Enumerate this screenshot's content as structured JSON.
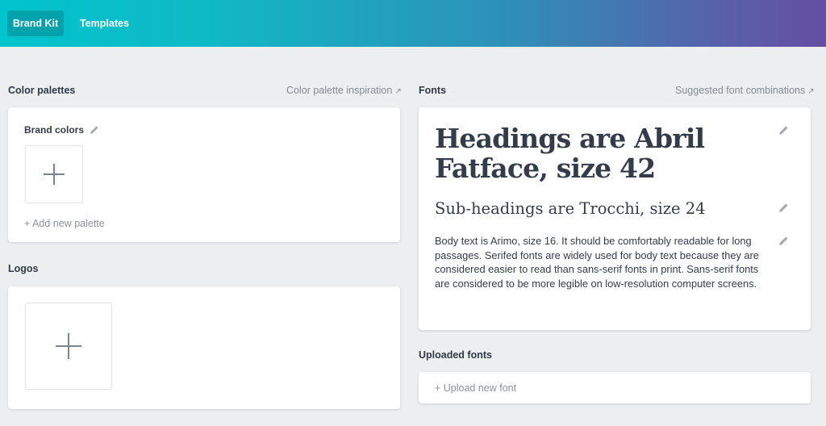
{
  "nav": {
    "tabs": [
      {
        "label": "Brand Kit",
        "active": true
      },
      {
        "label": "Templates",
        "active": false
      }
    ]
  },
  "colors": {
    "accent": "#00c4cc",
    "gradient_end": "#654fa2",
    "background": "#eceef0",
    "text": "#333c48",
    "muted": "#838b94"
  },
  "color_palettes": {
    "title": "Color palettes",
    "link": "Color palette inspiration",
    "link_icon": "external-arrow-icon",
    "palette_name": "Brand colors",
    "add_tile_icon": "plus-icon",
    "add_palette": "+ Add new palette"
  },
  "logos": {
    "title": "Logos",
    "add_tile_icon": "plus-icon"
  },
  "fonts": {
    "title": "Fonts",
    "link": "Suggested font combinations",
    "link_icon": "external-arrow-icon",
    "heading_sample": "Headings are Abril Fatface, size 42",
    "subheading_sample": "Sub-headings are Trocchi, size 24",
    "body_sample": "Body text is Arimo, size 16. It should be comfortably readable for long passages. Serifed fonts are widely used for body text because they are considered easier to read than sans-serif fonts in print. Sans-serif fonts are considered to be more legible on low-resolution computer screens.",
    "edit_icon": "pencil-icon"
  },
  "uploaded_fonts": {
    "title": "Uploaded fonts",
    "upload": "+ Upload new font"
  }
}
